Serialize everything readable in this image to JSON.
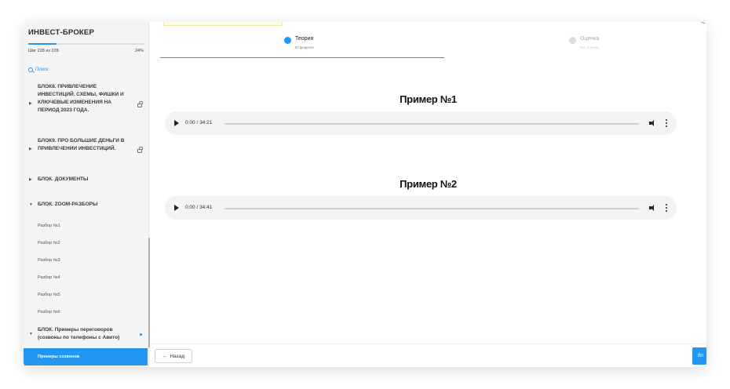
{
  "sidebar": {
    "title": "ИНВЕСТ-БРОКЕР",
    "step": "Шаг 228 из 228",
    "percent": "24%",
    "progress": 0.24,
    "search": "Поиск",
    "blocks": [
      {
        "label": "БЛОК8. ПРИВЛЕЧЕНИЕ ИНВЕСТИЦИЙ. СХЕМЫ, ФИШКИ И КЛЮЧЕВЫЕ ИЗМЕНЕНИЯ НА ПЕРИОД 2023 ГОДА.",
        "arrow": "▶",
        "locked": true
      },
      {
        "label": "БЛОК9. ПРО БОЛЬШИЕ ДЕНЬГИ В ПРИВЛЕЧЕНИИ ИНВЕСТИЦИЙ.",
        "arrow": "▶",
        "locked": true
      },
      {
        "label": "БЛОК. ДОКУМЕНТЫ",
        "arrow": "▶",
        "locked": false
      },
      {
        "label": "БЛОК. ZOOM-РАЗБОРЫ",
        "arrow": "▼",
        "locked": false
      },
      {
        "label": "БЛОК. Примеры переговоров (созвоны по телефоны с Авито)",
        "arrow": "▼",
        "locked": false
      }
    ],
    "subitems": [
      "Разбор №1",
      "Разбор №2",
      "Разбор №3",
      "Разбор №4",
      "Разбор №5",
      "Разбор №6"
    ],
    "active_item": "Примеры созвонов"
  },
  "tabs": [
    {
      "title": "Теория",
      "subtitle": "В процессе",
      "active": true
    },
    {
      "title": "Оценка",
      "subtitle": "Нет оценки",
      "active": false
    }
  ],
  "main": {
    "examples": [
      {
        "heading": "Пример №1",
        "time": "0:00 / 34:21"
      },
      {
        "heading": "Пример №2",
        "time": "0:00 / 34:41"
      }
    ]
  },
  "footer": {
    "back_label": "Назад",
    "next_label": "Вп"
  },
  "colors": {
    "accent": "#2196f3",
    "active_bg": "#2196f3"
  }
}
